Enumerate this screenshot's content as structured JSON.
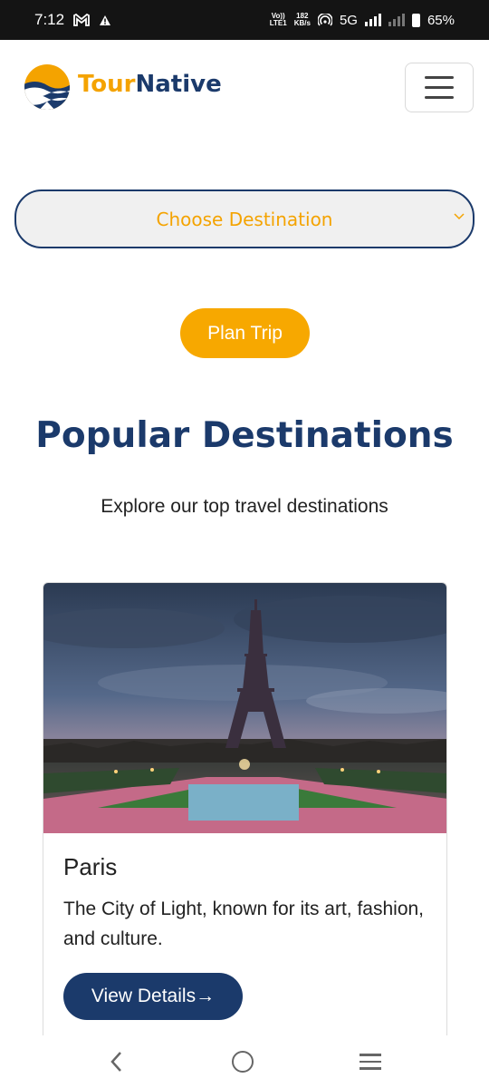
{
  "status_bar": {
    "time": "7:12",
    "volte_top": "Vo))",
    "volte_bottom": "LTE1",
    "speed_value": "182",
    "speed_unit": "KB/s",
    "network": "5G",
    "battery": "65%",
    "icons": [
      "gmail-icon",
      "alert-icon",
      "hotspot-icon",
      "signal-icon",
      "battery-icon"
    ]
  },
  "header": {
    "brand_part1": "Tour",
    "brand_part2": "Native",
    "menu_icon": "hamburger-icon"
  },
  "destination_select": {
    "placeholder": "Choose Destination",
    "icon": "chevron-down-icon"
  },
  "plan_button": {
    "label": "Plan Trip"
  },
  "popular": {
    "title": "Popular Destinations",
    "subtitle": "Explore our top travel destinations"
  },
  "cards": [
    {
      "title": "Paris",
      "description": "The City of Light, known for its art, fashion, and culture.",
      "button_label": "View Details→",
      "image": "eiffel-tower-photo"
    }
  ],
  "nav_bar": {
    "icons": [
      "back-icon",
      "home-icon",
      "recents-icon"
    ]
  },
  "colors": {
    "brand_orange": "#f4a300",
    "brand_navy": "#1b3a6b",
    "button_orange": "#f7a800"
  }
}
